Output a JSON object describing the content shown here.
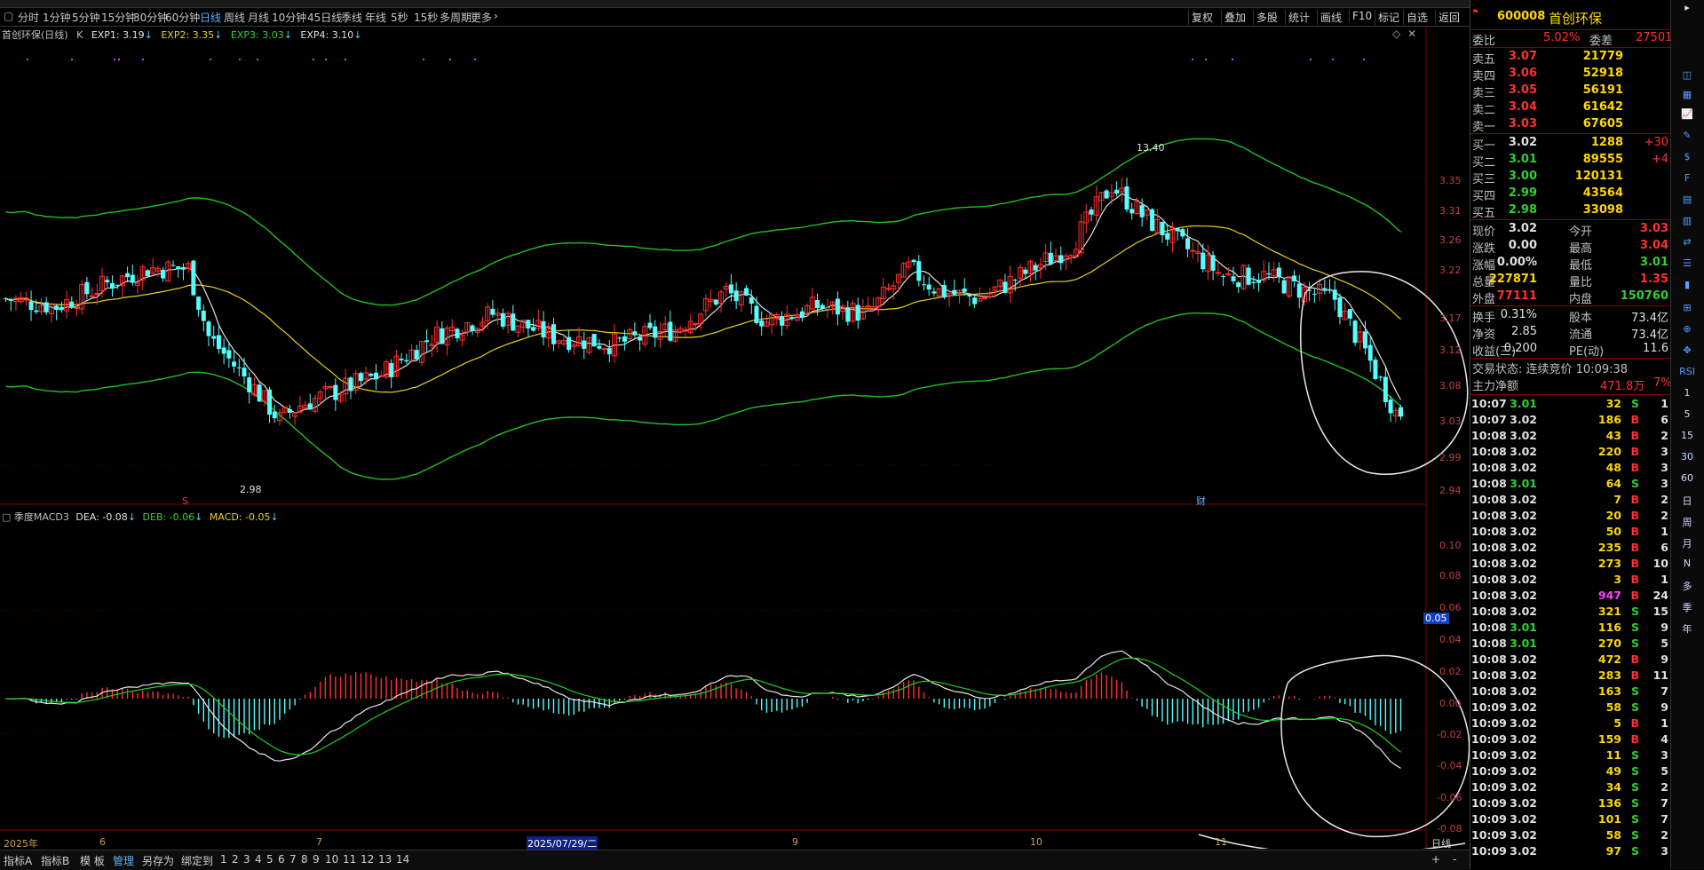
{
  "period_bar": {
    "items": [
      "分时",
      "1分钟",
      "5分钟",
      "15分钟",
      "30分钟",
      "60分钟",
      "日线",
      "周线",
      "月线",
      "10分钟",
      "45日线",
      "季线",
      "年线",
      "5秒",
      "15秒",
      "多周期",
      "更多"
    ],
    "active": "日线",
    "tools": [
      "复权",
      "叠加",
      "多股",
      "统计",
      "画线",
      "F10",
      "标记",
      "自选",
      "返回"
    ]
  },
  "legend_main": {
    "title": "首创环保(日线)",
    "k": "K",
    "exp1": "EXP1: 3.19",
    "exp2": "EXP2: 3.35",
    "exp3": "EXP3: 3.03",
    "exp4": "EXP4: 3.10"
  },
  "legend_macd": {
    "title": "季度MACD3",
    "dea": "DEA: -0.08",
    "deb": "DEB: -0.06",
    "macd": "MACD: -0.05"
  },
  "annotations": {
    "high_label": "13.40",
    "low_label": "2.98",
    "marker_s": "S",
    "marker_cai": "财",
    "macd_tag": "0.05"
  },
  "price_axis": [
    "3.35",
    "3.31",
    "3.26",
    "3.22",
    "3.17",
    "3.12",
    "3.08",
    "3.03",
    "2.99",
    "2.94"
  ],
  "macd_axis": [
    "0.10",
    "0.08",
    "0.06",
    "0.04",
    "0.02",
    "0.00",
    "-0.02",
    "-0.04",
    "-0.06",
    "-0.08"
  ],
  "date_axis": [
    "2025年",
    "6",
    "7",
    "2025/07/29/二",
    "9",
    "10",
    "11",
    "日线"
  ],
  "bottom_bar": {
    "tabs": [
      "指标A",
      "指标B",
      "模 板",
      "管理",
      "另存为",
      "绑定到"
    ],
    "active": "管理",
    "nums": [
      "1",
      "2",
      "3",
      "4",
      "5",
      "6",
      "7",
      "8",
      "9",
      "10",
      "11",
      "12",
      "13",
      "14"
    ],
    "plus": "+",
    "minus": "-"
  },
  "quote": {
    "code": "600008",
    "name": "首创环保",
    "weibi_label": "委比",
    "weibi": "5.02%",
    "weicha_label": "委差",
    "weicha": "27501",
    "asks": [
      {
        "label": "卖五",
        "price": "3.07",
        "vol": "21779"
      },
      {
        "label": "卖四",
        "price": "3.06",
        "vol": "52918"
      },
      {
        "label": "卖三",
        "price": "3.05",
        "vol": "56191"
      },
      {
        "label": "卖二",
        "price": "3.04",
        "vol": "61642"
      },
      {
        "label": "卖一",
        "price": "3.03",
        "vol": "67605"
      }
    ],
    "bids": [
      {
        "label": "买一",
        "price": "3.02",
        "vol": "1288",
        "chg": "+30"
      },
      {
        "label": "买二",
        "price": "3.01",
        "vol": "89555",
        "chg": "+4"
      },
      {
        "label": "买三",
        "price": "3.00",
        "vol": "120131",
        "chg": ""
      },
      {
        "label": "买四",
        "price": "2.99",
        "vol": "43564",
        "chg": ""
      },
      {
        "label": "买五",
        "price": "2.98",
        "vol": "33098",
        "chg": ""
      }
    ],
    "stats": [
      {
        "l1": "现价",
        "v1": "3.02",
        "l2": "今开",
        "v2": "3.03"
      },
      {
        "l1": "涨跌",
        "v1": "0.00",
        "l2": "最高",
        "v2": "3.04"
      },
      {
        "l1": "涨幅",
        "v1": "0.00%",
        "l2": "最低",
        "v2": "3.01"
      },
      {
        "l1": "总量",
        "v1": "227871",
        "l2": "量比",
        "v2": "1.35"
      },
      {
        "l1": "外盘",
        "v1": "77111",
        "l2": "内盘",
        "v2": "150760"
      }
    ],
    "stats2": [
      {
        "l1": "换手",
        "v1": "0.31%",
        "l2": "股本",
        "v2": "73.4亿"
      },
      {
        "l1": "净资",
        "v1": "2.85",
        "l2": "流通",
        "v2": "73.4亿"
      },
      {
        "l1": "收益(三)",
        "v1": "0.200",
        "l2": "PE(动)",
        "v2": "11.6"
      }
    ],
    "trade_state": "交易状态: 连续竞价 10:09:38",
    "main_flow_label": "主力净额",
    "main_flow": "471.8万",
    "main_flow_pct": "7%"
  },
  "ticks": [
    {
      "t": "10:07",
      "p": "3.01",
      "v": "32",
      "d": "S",
      "n": "1"
    },
    {
      "t": "10:07",
      "p": "3.02",
      "v": "186",
      "d": "B",
      "n": "6"
    },
    {
      "t": "10:08",
      "p": "3.02",
      "v": "43",
      "d": "B",
      "n": "2"
    },
    {
      "t": "10:08",
      "p": "3.02",
      "v": "220",
      "d": "B",
      "n": "3"
    },
    {
      "t": "10:08",
      "p": "3.02",
      "v": "48",
      "d": "B",
      "n": "3"
    },
    {
      "t": "10:08",
      "p": "3.01",
      "v": "64",
      "d": "S",
      "n": "3"
    },
    {
      "t": "10:08",
      "p": "3.02",
      "v": "7",
      "d": "B",
      "n": "2"
    },
    {
      "t": "10:08",
      "p": "3.02",
      "v": "20",
      "d": "B",
      "n": "2"
    },
    {
      "t": "10:08",
      "p": "3.02",
      "v": "50",
      "d": "B",
      "n": "1"
    },
    {
      "t": "10:08",
      "p": "3.02",
      "v": "235",
      "d": "B",
      "n": "6"
    },
    {
      "t": "10:08",
      "p": "3.02",
      "v": "273",
      "d": "B",
      "n": "10"
    },
    {
      "t": "10:08",
      "p": "3.02",
      "v": "3",
      "d": "B",
      "n": "1"
    },
    {
      "t": "10:08",
      "p": "3.02",
      "v": "947",
      "d": "B",
      "n": "24"
    },
    {
      "t": "10:08",
      "p": "3.02",
      "v": "321",
      "d": "S",
      "n": "15"
    },
    {
      "t": "10:08",
      "p": "3.01",
      "v": "116",
      "d": "S",
      "n": "9"
    },
    {
      "t": "10:08",
      "p": "3.01",
      "v": "270",
      "d": "S",
      "n": "5"
    },
    {
      "t": "10:08",
      "p": "3.02",
      "v": "472",
      "d": "B",
      "n": "9"
    },
    {
      "t": "10:08",
      "p": "3.02",
      "v": "283",
      "d": "B",
      "n": "11"
    },
    {
      "t": "10:08",
      "p": "3.02",
      "v": "163",
      "d": "S",
      "n": "7"
    },
    {
      "t": "10:09",
      "p": "3.02",
      "v": "58",
      "d": "S",
      "n": "9"
    },
    {
      "t": "10:09",
      "p": "3.02",
      "v": "5",
      "d": "B",
      "n": "1"
    },
    {
      "t": "10:09",
      "p": "3.02",
      "v": "159",
      "d": "B",
      "n": "4"
    },
    {
      "t": "10:09",
      "p": "3.02",
      "v": "11",
      "d": "S",
      "n": "3"
    },
    {
      "t": "10:09",
      "p": "3.02",
      "v": "49",
      "d": "S",
      "n": "5"
    },
    {
      "t": "10:09",
      "p": "3.02",
      "v": "34",
      "d": "S",
      "n": "2"
    },
    {
      "t": "10:09",
      "p": "3.02",
      "v": "136",
      "d": "S",
      "n": "7"
    },
    {
      "t": "10:09",
      "p": "3.02",
      "v": "101",
      "d": "S",
      "n": "7"
    },
    {
      "t": "10:09",
      "p": "3.02",
      "v": "58",
      "d": "S",
      "n": "2"
    },
    {
      "t": "10:09",
      "p": "3.02",
      "v": "97",
      "d": "S",
      "n": "3"
    }
  ],
  "side_icons": [
    "RSI",
    "1",
    "5",
    "15",
    "30",
    "60",
    "日",
    "周",
    "月",
    "N",
    "多",
    "季",
    "年"
  ],
  "colors": {
    "up": "#ff3030",
    "down": "#54ffff",
    "ma_white": "#e0e0e0",
    "ma_yellow": "#e8d020",
    "band_green": "#20c020",
    "macd_green": "#20d020"
  }
}
